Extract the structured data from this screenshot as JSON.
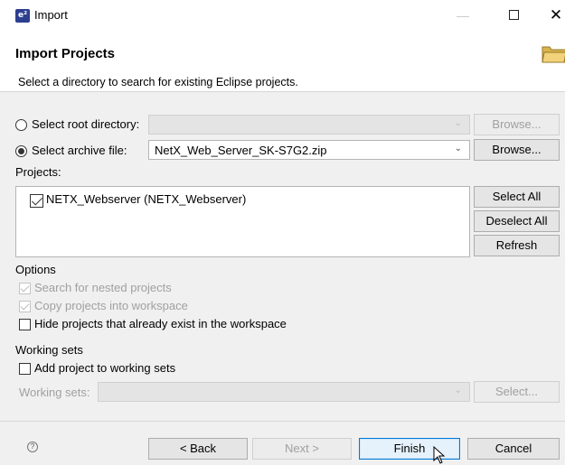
{
  "window": {
    "title": "Import",
    "app_icon_glyph": "e²"
  },
  "header": {
    "title": "Import Projects",
    "description": "Select a directory to search for existing Eclipse projects."
  },
  "source": {
    "root_directory": {
      "label": "Select root directory:",
      "selected": false,
      "value": "",
      "enabled": false,
      "browse_label": "Browse..."
    },
    "archive_file": {
      "label": "Select archive file:",
      "selected": true,
      "value": "NetX_Web_Server_SK-S7G2.zip",
      "enabled": true,
      "browse_label": "Browse..."
    }
  },
  "projects": {
    "label": "Projects:",
    "items": [
      {
        "label": "NETX_Webserver (NETX_Webserver)",
        "checked": true
      }
    ],
    "buttons": {
      "select_all": "Select All",
      "deselect_all": "Deselect All",
      "refresh": "Refresh"
    }
  },
  "options": {
    "label": "Options",
    "search_nested": {
      "label": "Search for nested projects",
      "checked": true,
      "enabled": false
    },
    "copy_into_workspace": {
      "label": "Copy projects into workspace",
      "checked": true,
      "enabled": false
    },
    "hide_existing": {
      "label": "Hide projects that already exist in the workspace",
      "checked": false,
      "enabled": true
    }
  },
  "working_sets": {
    "label": "Working sets",
    "add_to_sets": {
      "label": "Add project to working sets",
      "checked": false
    },
    "sets_label": "Working sets:",
    "sets_value": "",
    "select_label": "Select..."
  },
  "footer": {
    "help_icon": "?",
    "back": "< Back",
    "next": "Next >",
    "finish": "Finish",
    "cancel": "Cancel"
  },
  "colors": {
    "accent": "#0078d7",
    "disabled_text": "#a0a0a0",
    "dialog_bg": "#f0f0f0"
  }
}
